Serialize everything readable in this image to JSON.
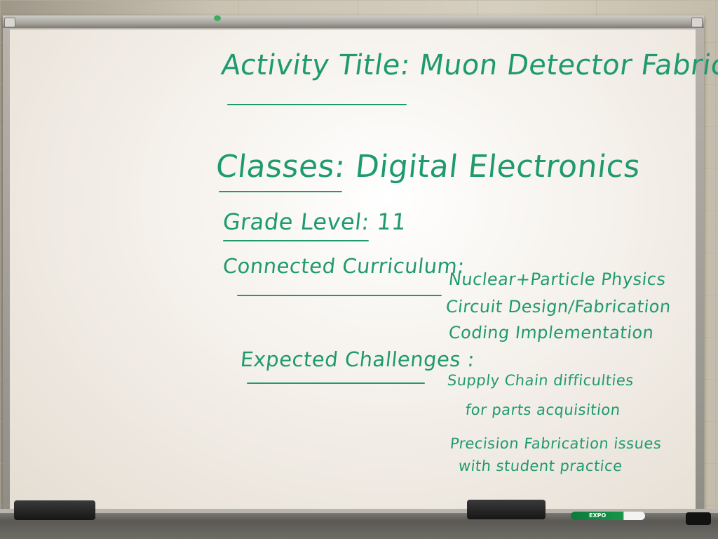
{
  "whiteboard": {
    "activity_title": "Activity Title: Muon Detector Fabrication",
    "classes": "Classes:  Digital Electronics",
    "grade_level": "Grade Level:  11",
    "connected_curriculum_label": "Connected Curriculum:",
    "connected_curriculum": [
      "Nuclear+Particle Physics",
      "Circuit Design/Fabrication",
      "Coding Implementation"
    ],
    "expected_challenges_label": "Expected Challenges :",
    "expected_challenges": [
      "Supply Chain difficulties",
      "for parts acquisition",
      "Precision Fabrication issues",
      "with student practice"
    ],
    "ink_color": "#1f9a6f"
  },
  "tray": {
    "marker_brand": "EXPO",
    "marker_color": "#14964a"
  }
}
